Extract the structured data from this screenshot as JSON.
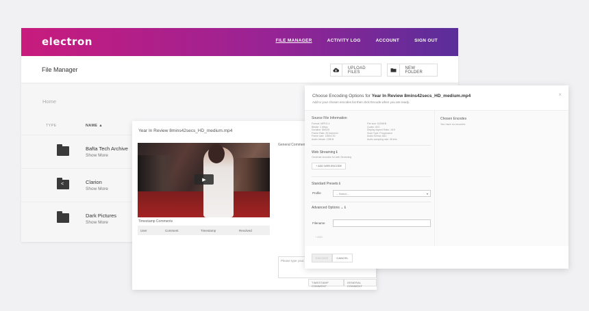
{
  "app": {
    "brand": "electron"
  },
  "nav": {
    "items": [
      "FILE MANAGER",
      "ACTIVITY LOG",
      "ACCOUNT",
      "SIGN OUT"
    ]
  },
  "toolbar": {
    "page_title": "File Manager",
    "upload_label": "UPLOAD FILES",
    "folder_label": "NEW FOLDER"
  },
  "breadcrumb": {
    "home": "Home"
  },
  "files": {
    "col_type": "TYPE",
    "col_name": "NAME ▲",
    "rows": [
      {
        "name": "Bafta Tech Archive",
        "more": "Show More",
        "icon": "folder-icon"
      },
      {
        "name": "Clarion",
        "more": "Show More",
        "icon": "shared-folder-icon"
      },
      {
        "name": "Dark Pictures",
        "more": "Show More",
        "icon": "folder-icon"
      }
    ]
  },
  "video": {
    "title": "Year In Review 8mins42secs_HD_medium.mp4",
    "general_comments": "General Comments",
    "timestamp_comments": "Timestamp Comments",
    "cols": [
      "User",
      "Comment",
      "Timestamp",
      "Resolved"
    ],
    "comment_placeholder": "Please type your...",
    "btn_timestamp": "TIMESTAMP COMMENT",
    "btn_general": "GENERAL COMMENT"
  },
  "encoding": {
    "title_prefix": "Choose Encoding Options for",
    "title_file": "Year In Review 8mins42secs_HD_medium.mp4",
    "subtitle": "Add to your chosen encodes list then click Encode when you are ready.",
    "source_h": "Source File Information",
    "source_left": [
      "Format: MPEG-4",
      "Bitrate: 1 Mbps",
      "Duration: 8M42S",
      "Frame Rate: 25 frames/s",
      "Frame size: 1280x720",
      "Audio bitrate: 128KB"
    ],
    "source_right": [
      "File size: 622MKB",
      "Codec: AVC",
      "Display Aspect Ratio: 16:9",
      "Scan Type: Progressive",
      "Audio format: AAC",
      "Audio sampling rate: 48 kHz"
    ],
    "web_h": "Web Streaming",
    "web_sub": "Generate encodes for web Streaming",
    "add_web_btn": "+ ADD WEB ENCODE",
    "presets_h": "Standard Presets",
    "profile_lbl": "Profile",
    "profile_val": "-- Select --",
    "advanced_h": "Advanced Options",
    "filename_lbl": "Filename",
    "add_link": "+ ADD",
    "chosen_h": "Chosen Encodes",
    "chosen_sub": "You have no encodes",
    "btn_encode": "ENCODE",
    "btn_cancel": "CANCEL"
  }
}
